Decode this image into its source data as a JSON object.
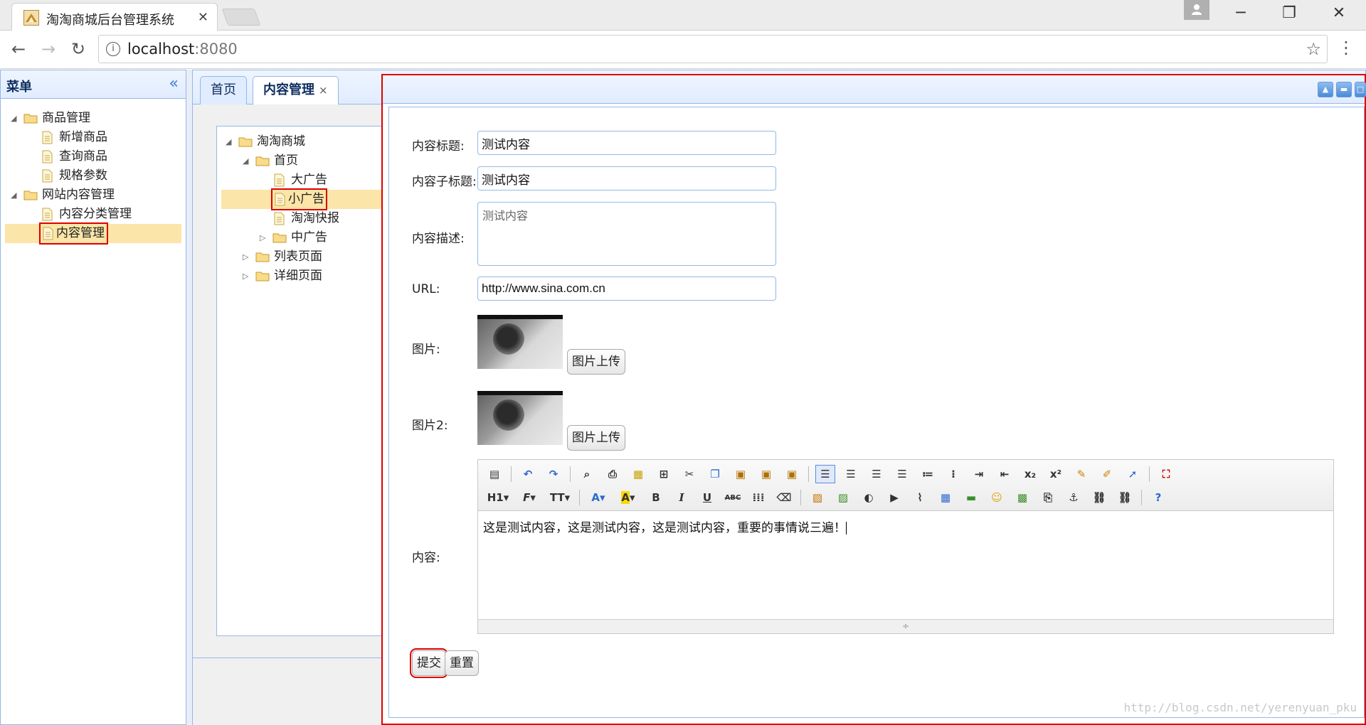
{
  "browser": {
    "tab_title": "淘淘商城后台管理系统",
    "tab_close": "✕",
    "url_host": "localhost",
    "url_port": ":8080",
    "minimize": "─",
    "restore": "❐",
    "close": "✕"
  },
  "west": {
    "title": "菜单",
    "collapse_glyph": "«",
    "items": [
      {
        "label": "商品管理"
      },
      {
        "label": "新增商品"
      },
      {
        "label": "查询商品"
      },
      {
        "label": "规格参数"
      },
      {
        "label": "网站内容管理"
      },
      {
        "label": "内容分类管理"
      },
      {
        "label": "内容管理"
      }
    ]
  },
  "center": {
    "tabs": [
      {
        "label": "首页"
      },
      {
        "label": "内容管理",
        "close": "×"
      }
    ],
    "tree": [
      {
        "label": "淘淘商城"
      },
      {
        "label": "首页"
      },
      {
        "label": "大广告"
      },
      {
        "label": "小广告"
      },
      {
        "label": "淘淘快报"
      },
      {
        "label": "中广告"
      },
      {
        "label": "列表页面"
      },
      {
        "label": "详细页面"
      }
    ]
  },
  "form": {
    "title_label": "内容标题:",
    "title_value": "测试内容",
    "subtitle_label": "内容子标题:",
    "subtitle_value": "测试内容",
    "desc_label": "内容描述:",
    "desc_value": "测试内容",
    "url_label": "URL:",
    "url_value": "http://www.sina.com.cn",
    "pic_label": "图片:",
    "pic_upload": "图片上传",
    "pic2_label": "图片2:",
    "pic2_upload": "图片上传",
    "content_label": "内容:",
    "content_value": "这是测试内容，这是测试内容，这是测试内容，重要的事情说三遍！",
    "submit": "提交",
    "reset": "重置"
  },
  "editor": {
    "row2": [
      "H1",
      "F",
      "TT",
      "A",
      "A",
      "B",
      "I",
      "U",
      "ABC"
    ]
  },
  "watermark": "http://blog.csdn.net/yerenyuan_pku"
}
